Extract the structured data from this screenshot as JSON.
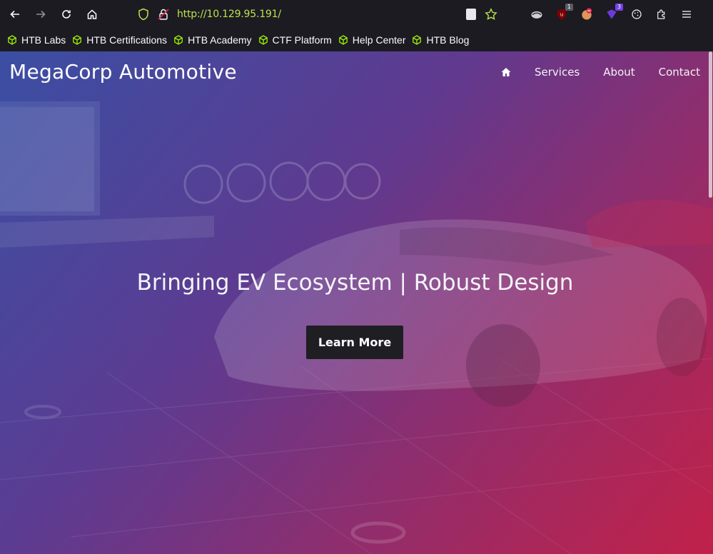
{
  "browser": {
    "url_scheme": "http://",
    "url_host": "10.129.95.191",
    "url_path": "/",
    "extensions": [
      {
        "name": "ublock-origin-icon",
        "badge": "1"
      },
      {
        "name": "cookie-extension-icon",
        "badge": ""
      },
      {
        "name": "wappalyzer-icon",
        "badge": "3"
      },
      {
        "name": "cookie-editor-icon",
        "badge": ""
      }
    ],
    "accent_color": "#b9e34a"
  },
  "bookmarks": [
    {
      "label": "HTB Labs"
    },
    {
      "label": "HTB Certifications"
    },
    {
      "label": "HTB Academy"
    },
    {
      "label": "CTF Platform"
    },
    {
      "label": "Help Center"
    },
    {
      "label": "HTB Blog"
    }
  ],
  "site": {
    "title": "MegaCorp Automotive",
    "nav": {
      "home_icon": "home-icon",
      "links": [
        {
          "label": "Services"
        },
        {
          "label": "About"
        },
        {
          "label": "Contact"
        }
      ]
    },
    "hero": {
      "heading": "Bringing EV Ecosystem | Robust Design",
      "button_label": "Learn More"
    },
    "colors": {
      "gradient_start": "#3a4c9b",
      "gradient_end": "#b8254d",
      "button_bg": "#1f1e22"
    }
  }
}
